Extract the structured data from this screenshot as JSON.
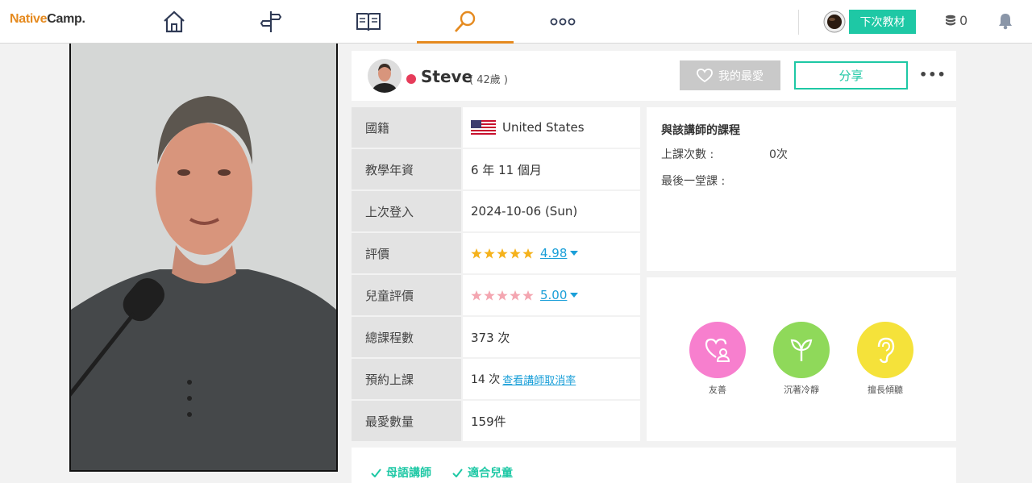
{
  "logo": {
    "part1": "Native",
    "part2": "Camp."
  },
  "nav": {
    "icons": [
      "home-icon",
      "signpost-icon",
      "book-icon",
      "search-icon",
      "more-dots-icon"
    ],
    "active": "search-icon",
    "next_material_label": "下次教材",
    "coins": "0"
  },
  "teacher": {
    "name": "Steve",
    "age": "( 42歲 )",
    "favorite_label": "我的最愛",
    "share_label": "分享"
  },
  "info": {
    "rows": [
      {
        "label": "國籍",
        "value": "United States"
      },
      {
        "label": "教學年資",
        "value": "6 年 11 個月"
      },
      {
        "label": "上次登入",
        "value": "2024-10-06 (Sun)"
      },
      {
        "label": "評價",
        "value": "4.98"
      },
      {
        "label": "兒童評價",
        "value": "5.00"
      },
      {
        "label": "總課程數",
        "value": "373 次"
      },
      {
        "label": "預約上課",
        "value": "14 次",
        "link": "查看講師取消率"
      },
      {
        "label": "最愛數量",
        "value": "159件"
      }
    ]
  },
  "history": {
    "title": "與該講師的課程",
    "lessons_label": "上課次數 :",
    "lessons_value": "0次",
    "last_label": "最後一堂課 :"
  },
  "traits": [
    {
      "label": "友善",
      "color": "#f77fce",
      "icon": "heart-person-icon"
    },
    {
      "label": "沉著冷靜",
      "color": "#8fd95a",
      "icon": "sprout-icon"
    },
    {
      "label": "擅長傾聽",
      "color": "#f5e23a",
      "icon": "ear-icon"
    }
  ],
  "tags": [
    "母語講師",
    "適合兒童"
  ],
  "colors": {
    "accent": "#1ec8a5",
    "nav_active": "#e58a1f",
    "link": "#1a9fd8",
    "star": "#f5b21c",
    "kids_star": "#f4a6b1"
  }
}
